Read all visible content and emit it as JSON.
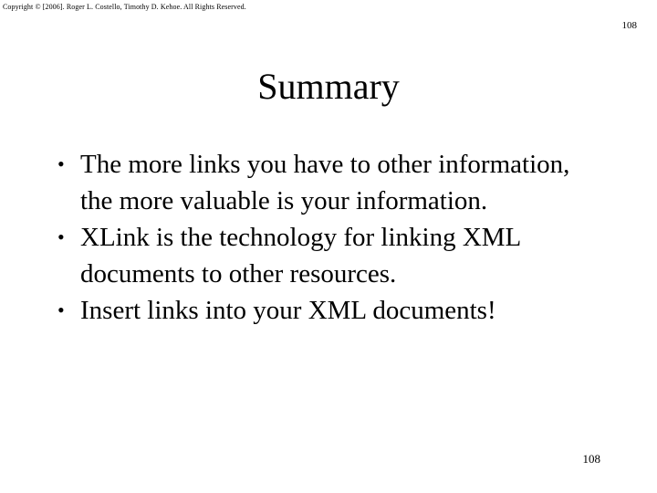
{
  "slide": {
    "copyright": "Copyright © [2006].  Roger L. Costello, Timothy D. Kehoe.  All Rights Reserved.",
    "page_number_top": "108",
    "page_number_bottom": "108",
    "title": "Summary",
    "bullet_marker": "•",
    "bullets": [
      {
        "text": "The more links you have to other information, the more valuable is your information."
      },
      {
        "text": "XLink is the technology for linking XML documents to other resources."
      },
      {
        "text": "Insert links into your XML documents!"
      }
    ]
  }
}
